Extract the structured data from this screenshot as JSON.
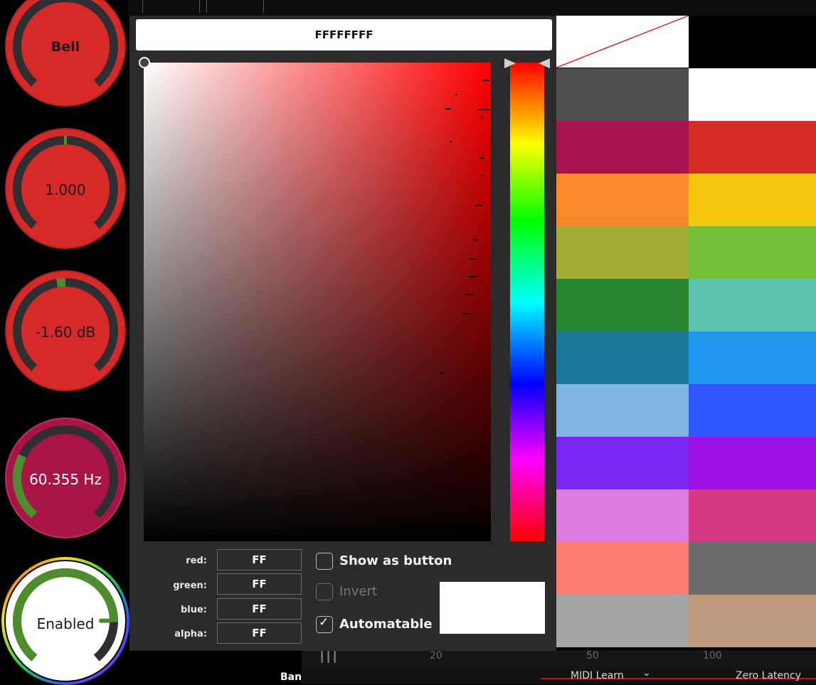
{
  "knobs": [
    {
      "label": "Bell",
      "fill": "#d62a28",
      "value": 0.0
    },
    {
      "label": "1.000",
      "fill": "#d62a28",
      "value": 0.5
    },
    {
      "label": "-1.60 dB",
      "fill": "#d62a28",
      "value": 0.47
    },
    {
      "label": "60.355 Hz",
      "fill": "#a81446",
      "value": 0.27
    },
    {
      "label": "Enabled",
      "fill": "#ffffff",
      "value": 0.82
    }
  ],
  "picker": {
    "hex_value": "FFFFFFFF",
    "channels": [
      {
        "label": "red:",
        "value": "FF"
      },
      {
        "label": "green:",
        "value": "FF"
      },
      {
        "label": "blue:",
        "value": "FF"
      },
      {
        "label": "alpha:",
        "value": "FF"
      }
    ],
    "show_as_button": {
      "label": "Show as button",
      "checked": false
    },
    "invert": {
      "label": "Invert",
      "checked": false,
      "disabled": true
    },
    "automatable": {
      "label": "Automatable",
      "checked": true,
      "check_glyph": "✓"
    },
    "preview_color": "#FFFFFF",
    "hue_color": "#FF0000"
  },
  "swatches": [
    {
      "left": "#505050",
      "right": "#ffffff"
    },
    {
      "left": "#a6134d",
      "right": "#d42b26"
    },
    {
      "left": "#fb8829",
      "right": "#f5c710"
    },
    {
      "left": "#a2ab32",
      "right": "#73c038"
    },
    {
      "left": "#27882f",
      "right": "#5dc3ad"
    },
    {
      "left": "#1c789b",
      "right": "#1d98ee"
    },
    {
      "left": "#82b4e4",
      "right": "#2f57fb"
    },
    {
      "left": "#7a28f1",
      "right": "#9d12e4"
    },
    {
      "left": "#e07de3",
      "right": "#d33781"
    },
    {
      "left": "#fc7d72",
      "right": "#6b6b6b"
    },
    {
      "left": "#a6a6a6",
      "right": "#bf9b7e"
    }
  ],
  "background": {
    "axis_labels": [
      "20",
      "50",
      "100"
    ],
    "piano_icon": "piano-icon",
    "midi_learn": "MIDI Learn",
    "midi_chevron": "⌄",
    "zero_latency": "Zero Latency",
    "band_label": "Banc"
  }
}
